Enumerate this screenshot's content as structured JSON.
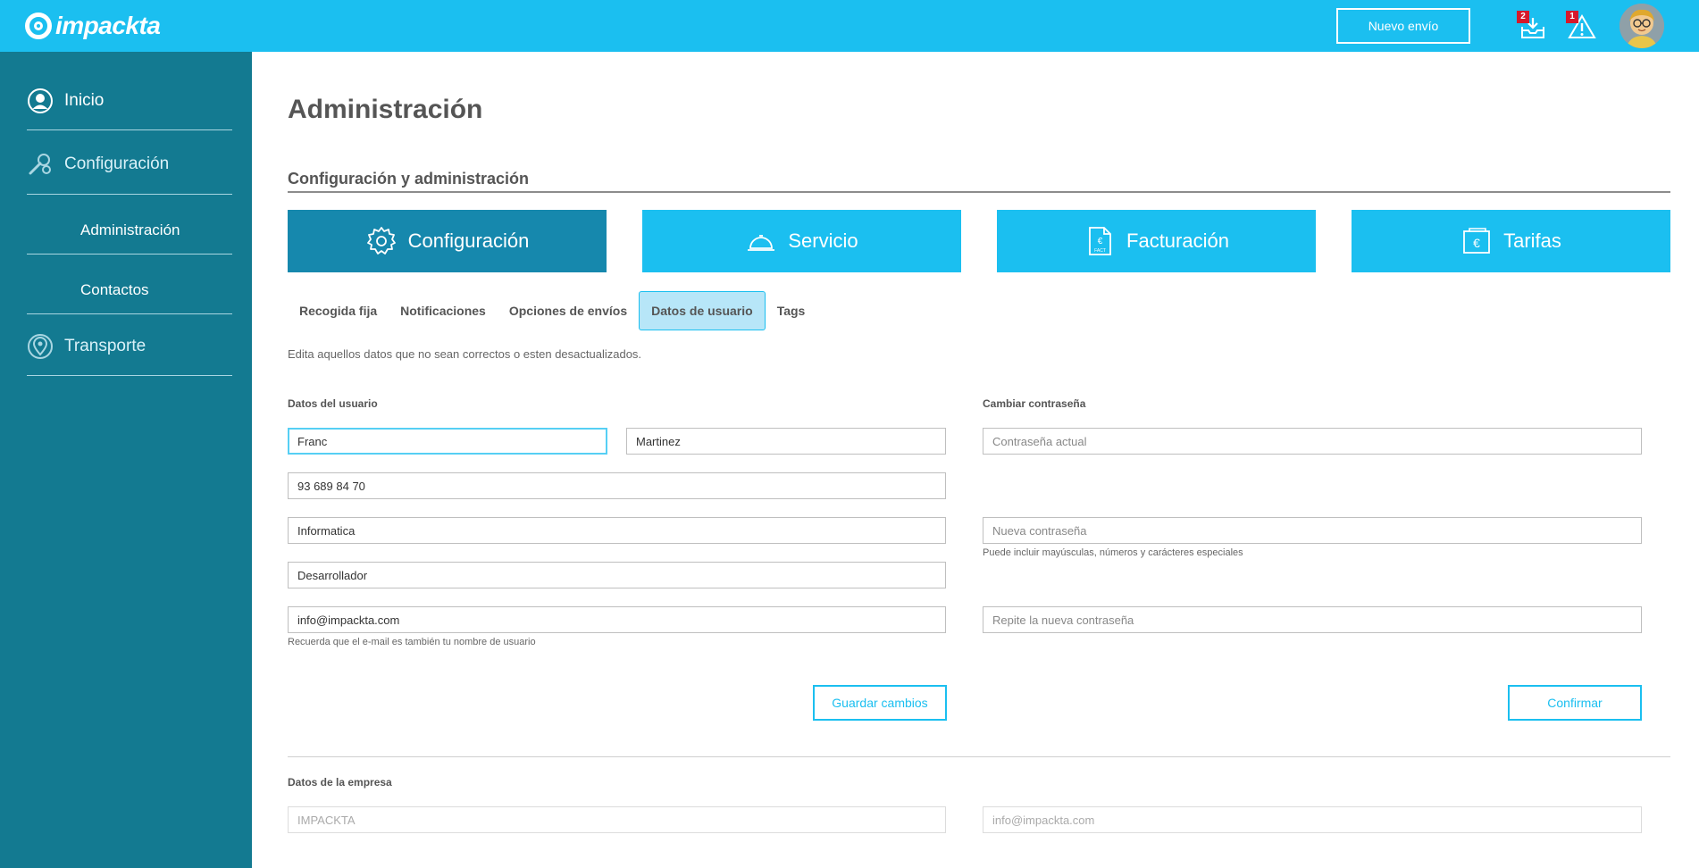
{
  "header": {
    "logo_text": "impackta",
    "new_shipment_label": "Nuevo envío",
    "downloads_badge": "2",
    "alerts_badge": "1"
  },
  "sidebar": {
    "items": [
      {
        "label": "Inicio",
        "icon": "user-circle-icon"
      },
      {
        "label": "Configuración",
        "icon": "wrench-gear-icon"
      },
      {
        "label": "Administración"
      },
      {
        "label": "Contactos"
      },
      {
        "label": "Transporte",
        "icon": "map-pin-icon"
      }
    ]
  },
  "main": {
    "page_title": "Administración",
    "section_title": "Configuración y administración",
    "big_tabs": [
      {
        "label": "Configuración",
        "icon": "gear-icon",
        "active": true
      },
      {
        "label": "Servicio",
        "icon": "service-bell-icon",
        "active": false
      },
      {
        "label": "Facturación",
        "icon": "invoice-icon",
        "active": false
      },
      {
        "label": "Tarifas",
        "icon": "euro-tag-icon",
        "active": false
      }
    ],
    "sub_tabs": [
      {
        "label": "Recogida fija"
      },
      {
        "label": "Notificaciones"
      },
      {
        "label": "Opciones de envíos"
      },
      {
        "label": "Datos de usuario",
        "active": true
      },
      {
        "label": "Tags"
      }
    ],
    "intro_text": "Edita aquellos datos que no sean correctos o esten desactualizados.",
    "user_data": {
      "label": "Datos del usuario",
      "first_name": "Franc",
      "last_name": "Martinez",
      "phone": "93 689 84 70",
      "department": "Informatica",
      "role": "Desarrollador",
      "email": "info@impackta.com",
      "email_hint": "Recuerda que el e-mail es también tu nombre de usuario",
      "save_label": "Guardar cambios"
    },
    "password": {
      "label": "Cambiar contraseña",
      "current_placeholder": "Contraseña actual",
      "new_placeholder": "Nueva contraseña",
      "new_hint": "Puede incluir mayúsculas, números y carácteres especiales",
      "repeat_placeholder": "Repite la nueva contraseña",
      "confirm_label": "Confirmar"
    },
    "company": {
      "label": "Datos de la empresa",
      "name_placeholder": "IMPACKTA",
      "email_placeholder": "info@impackta.com"
    }
  },
  "colors": {
    "brand": "#1bbff0",
    "sidebar": "#137a91",
    "active_tab": "#1688ad"
  }
}
